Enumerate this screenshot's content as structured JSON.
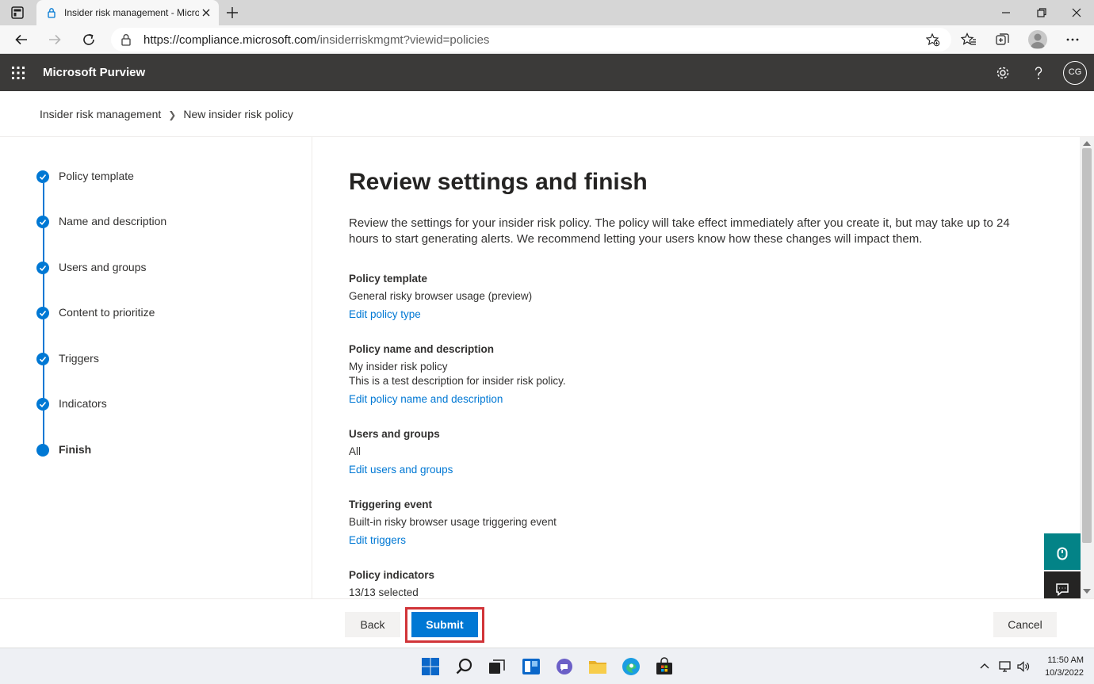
{
  "browser": {
    "tab_title": "Insider risk management - Micro",
    "url_host": "https://compliance.microsoft.com",
    "url_path": "/insiderriskmgmt?viewid=policies"
  },
  "header": {
    "brand": "Microsoft Purview",
    "avatar_initials": "CG",
    "icons": [
      "app-launcher-icon",
      "settings-gear-icon",
      "help-question-icon"
    ]
  },
  "breadcrumb": {
    "items": [
      "Insider risk management",
      "New insider risk policy"
    ]
  },
  "steps": [
    {
      "label": "Policy template",
      "state": "completed"
    },
    {
      "label": "Name and description",
      "state": "completed"
    },
    {
      "label": "Users and groups",
      "state": "completed"
    },
    {
      "label": "Content to prioritize",
      "state": "completed"
    },
    {
      "label": "Triggers",
      "state": "completed"
    },
    {
      "label": "Indicators",
      "state": "completed"
    },
    {
      "label": "Finish",
      "state": "current"
    }
  ],
  "main": {
    "title": "Review settings and finish",
    "intro": "Review the settings for your insider risk policy. The policy will take effect immediately after you create it, but may take up to 24 hours to start generating alerts. We recommend letting your users know how these changes will impact them.",
    "sections": [
      {
        "heading": "Policy template",
        "values": [
          "General risky browser usage (preview)"
        ],
        "link": "Edit policy type"
      },
      {
        "heading": "Policy name and description",
        "values": [
          "My insider risk policy",
          "This is a test description for insider risk policy."
        ],
        "link": "Edit policy name and description"
      },
      {
        "heading": "Users and groups",
        "values": [
          "All"
        ],
        "link": "Edit users and groups"
      },
      {
        "heading": "Triggering event",
        "values": [
          "Built-in risky browser usage triggering event"
        ],
        "link": "Edit triggers"
      },
      {
        "heading": "Policy indicators",
        "values": [
          "13/13 selected"
        ],
        "link": ""
      }
    ]
  },
  "footer": {
    "back_label": "Back",
    "submit_label": "Submit",
    "cancel_label": "Cancel"
  },
  "taskbar": {
    "time": "11:50 AM",
    "date": "10/3/2022"
  },
  "colors": {
    "accent": "#0078d4",
    "header_bg": "#3b3a39",
    "highlight": "#d13438",
    "help_button": "#038387"
  }
}
